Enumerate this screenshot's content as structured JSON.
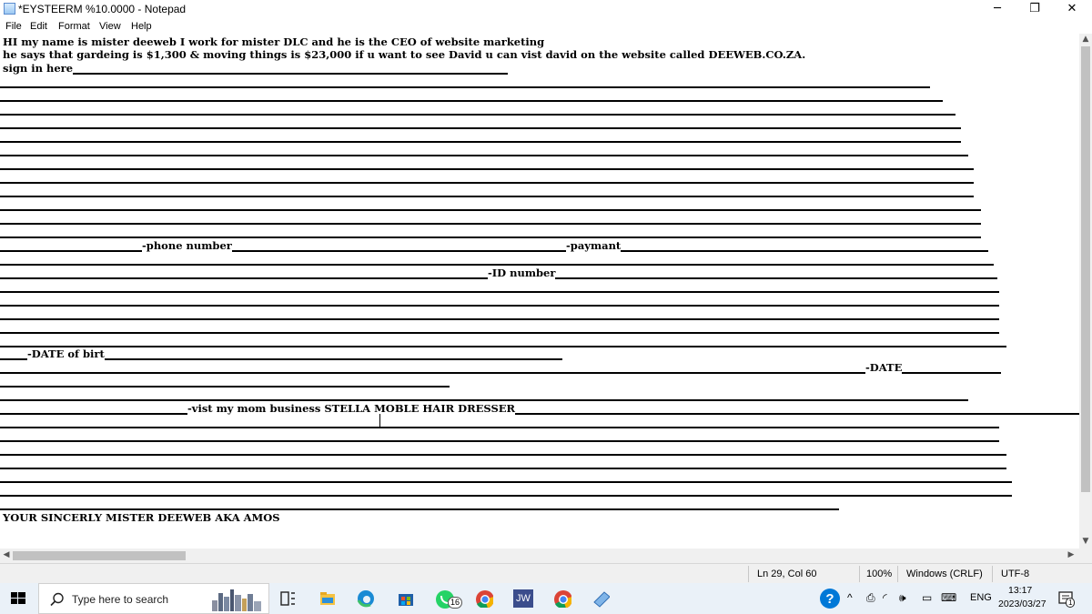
{
  "window": {
    "title": "*EYSTEERM %10.0000 - Notepad",
    "minimize_glyph": "─",
    "restore_glyph": "❐",
    "close_glyph": "✕"
  },
  "menu": {
    "file": "File",
    "edit": "Edit",
    "format": "Format",
    "view": "View",
    "help": "Help"
  },
  "document": {
    "line1": "HI my name is mister deeweb I work for mister DLC and he is the CEO of website marketing",
    "line2": "he says that gardeing is $1,300 & moving things is $23,000 if u want to see David u can vist david on the website called DEEWEB.CO.ZA.",
    "line3": "sign in here",
    "phone_label": "-phone number",
    "payment_label": "-paymant",
    "id_label": "-ID number",
    "dob_label": "-DATE of birt",
    "date_label": "-DATE",
    "visit_label": "-vist my mom business STELLA MOBLE HAIR DRESSER",
    "signoff": "YOUR SINCERLY MISTER DEEWEB AKA AMOS"
  },
  "status": {
    "position": "Ln 29, Col 60",
    "zoom": "100%",
    "line_ending": "Windows (CRLF)",
    "encoding": "UTF-8"
  },
  "taskbar": {
    "search_placeholder": "Type here to search",
    "whatsapp_badge": "16",
    "jw_label": "JW",
    "language": "ENG",
    "time": "13:17",
    "date": "2023/03/27",
    "notification_count": "1",
    "help_glyph": "?"
  },
  "icons": [
    "notepad-icon",
    "windows-start-icon",
    "search-icon",
    "city-skyline-icon",
    "task-view-icon",
    "file-explorer-icon",
    "edge-icon",
    "microsoft-store-icon",
    "whatsapp-icon",
    "chrome-icon",
    "jw-library-icon",
    "chrome-icon-alt",
    "notepad-taskbar-icon",
    "help-icon",
    "chevron-up-icon",
    "meet-now-icon",
    "wifi-icon",
    "volume-icon",
    "battery-icon",
    "keyboard-icon",
    "notification-icon"
  ],
  "colors": {
    "accent": "#0078d7",
    "taskbar": "#eaf1f8",
    "whatsapp": "#25d366",
    "chrome_red": "#db4437"
  }
}
